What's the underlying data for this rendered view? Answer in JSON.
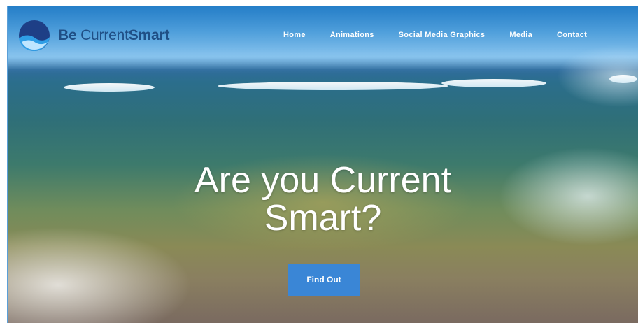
{
  "brand": {
    "name_bold": "Be",
    "name_regular": "Current",
    "name_strong": "Smart",
    "logo_icon": "wave-globe-icon",
    "colors": {
      "text": "#1f4f86",
      "mark_dark": "#1e3f86",
      "mark_light": "#2f9ee6"
    }
  },
  "nav": {
    "items": [
      {
        "label": "Home"
      },
      {
        "label": "Animations"
      },
      {
        "label": "Social Media Graphics"
      },
      {
        "label": "Media"
      },
      {
        "label": "Contact"
      }
    ]
  },
  "hero": {
    "headline_line1": "Are you Current",
    "headline_line2": "Smart?",
    "cta_label": "Find Out",
    "cta_color": "#3a86d6"
  }
}
